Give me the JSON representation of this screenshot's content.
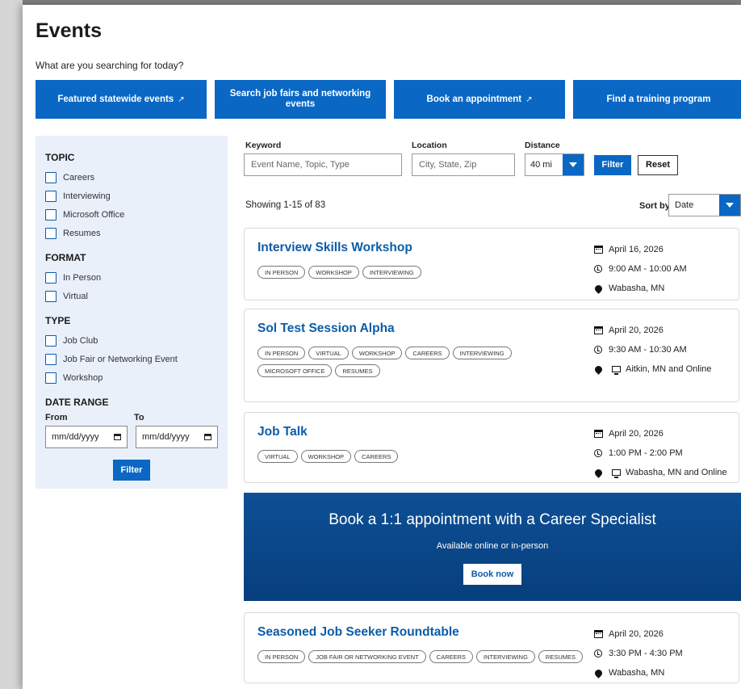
{
  "page": {
    "title": "Events",
    "prompt": "What are you searching for today?"
  },
  "quick_links": [
    {
      "label": "Featured statewide events",
      "external": true
    },
    {
      "label": "Search job fairs and networking events",
      "external": false
    },
    {
      "label": "Book an appointment",
      "external": true
    },
    {
      "label": "Find a training program",
      "external": false
    }
  ],
  "external_icon": "external-link-icon",
  "sidebar": {
    "topic": {
      "heading": "TOPIC",
      "options": [
        "Careers",
        "Interviewing",
        "Microsoft Office",
        "Resumes"
      ]
    },
    "format": {
      "heading": "FORMAT",
      "options": [
        "In Person",
        "Virtual"
      ]
    },
    "type": {
      "heading": "TYPE",
      "options": [
        "Job Club",
        "Job Fair or Networking Event",
        "Workshop"
      ]
    },
    "date_range": {
      "heading": "DATE RANGE",
      "from_label": "From",
      "to_label": "To",
      "from_value": "mm/dd/yyyy",
      "to_value": "mm/dd/yyyy"
    },
    "filter_label": "Filter"
  },
  "search": {
    "keyword_label": "Keyword",
    "keyword_placeholder": "Event Name, Topic, Type",
    "location_label": "Location",
    "location_placeholder": "City, State, Zip",
    "distance_label": "Distance",
    "distance_value": "40 mi",
    "filter_label": "Filter",
    "reset_label": "Reset"
  },
  "results": {
    "count_text": "Showing 1-15 of 83",
    "sort_label": "Sort by",
    "sort_value": "Date"
  },
  "events": [
    {
      "title": "Interview Skills Workshop",
      "tags": [
        "IN PERSON",
        "WORKSHOP",
        "INTERVIEWING"
      ],
      "date": "April 16, 2026",
      "time": "9:00 AM - 10:00 AM",
      "location": "Wabasha, MN",
      "online": false
    },
    {
      "title": "Sol Test Session Alpha",
      "tags": [
        "IN PERSON",
        "VIRTUAL",
        "WORKSHOP",
        "CAREERS",
        "INTERVIEWING",
        "MICROSOFT OFFICE",
        "RESUMES"
      ],
      "date": "April 20, 2026",
      "time": "9:30 AM - 10:30 AM",
      "location": "Aitkin, MN and Online",
      "online": true
    },
    {
      "title": "Job Talk",
      "tags": [
        "VIRTUAL",
        "WORKSHOP",
        "CAREERS"
      ],
      "date": "April 20, 2026",
      "time": "1:00 PM - 2:00 PM",
      "location": "Wabasha, MN and Online",
      "online": true
    },
    {
      "title": "Seasoned Job Seeker Roundtable",
      "tags": [
        "IN PERSON",
        "JOB FAIR OR NETWORKING EVENT",
        "CAREERS",
        "INTERVIEWING",
        "RESUMES"
      ],
      "date": "April 20, 2026",
      "time": "3:30 PM - 4:30 PM",
      "location": "Wabasha, MN",
      "online": false
    }
  ],
  "promo": {
    "title": "Book a 1:1 appointment with a Career Specialist",
    "subtitle": "Available online or in-person",
    "button_label": "Book now"
  },
  "colors": {
    "primary": "#0a67c4",
    "link": "#0b5da8",
    "sidebar_bg": "#e9f0fa",
    "banner": "#0d4f95"
  }
}
